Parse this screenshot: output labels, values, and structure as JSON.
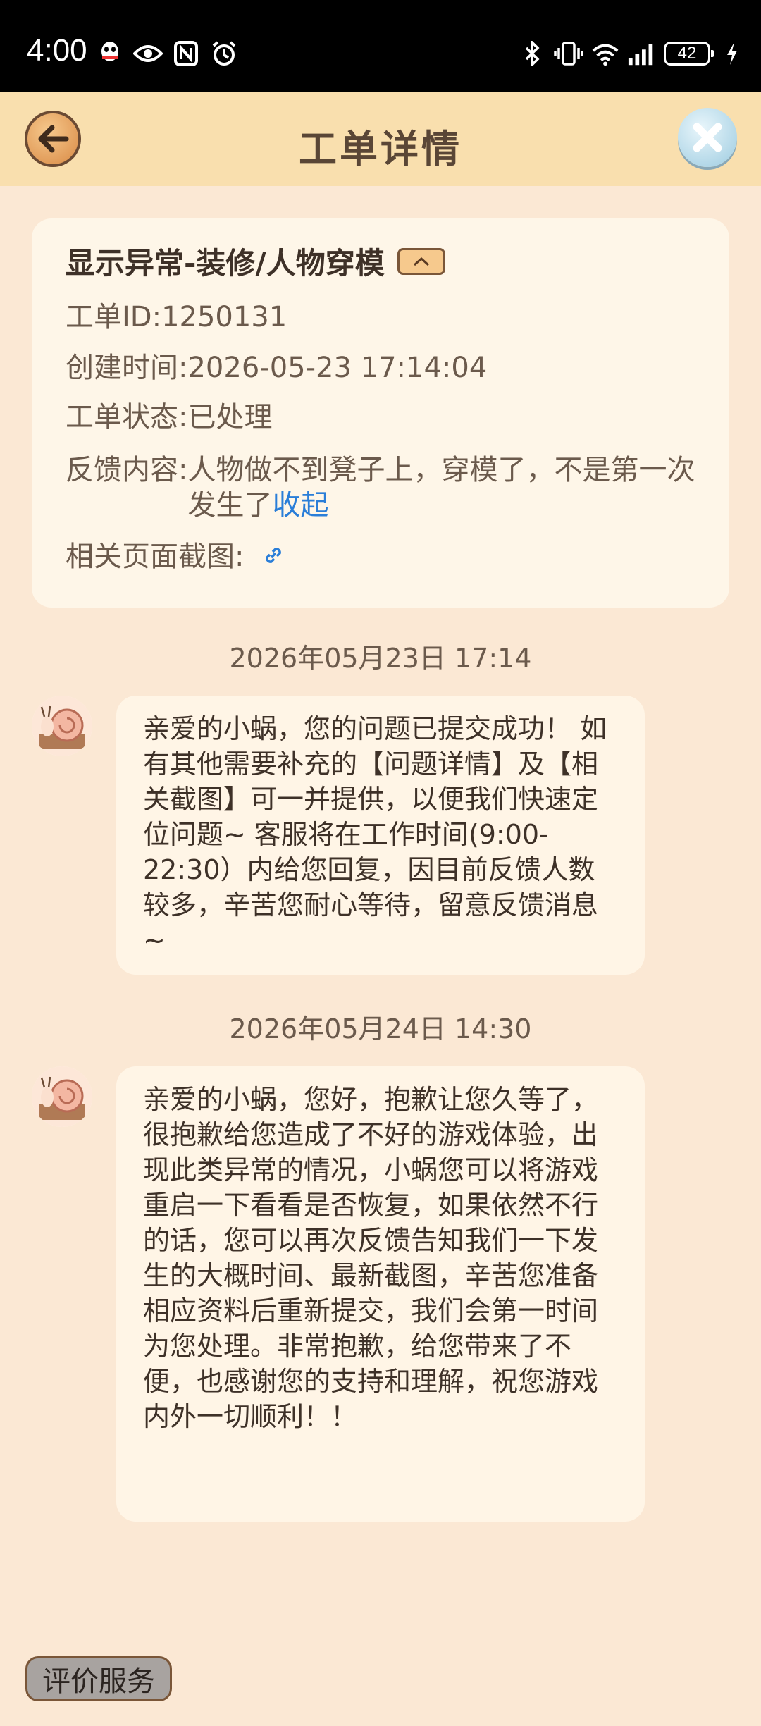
{
  "status_bar": {
    "time": "4:00",
    "battery": "42",
    "left_icons": [
      "qq-icon",
      "eye-icon",
      "nfc-icon",
      "alarm-icon"
    ],
    "right_icons": [
      "bluetooth-icon",
      "vibrate-icon",
      "wifi-icon",
      "signal-icon",
      "battery-icon",
      "charging-icon"
    ]
  },
  "header": {
    "title": "工单详情"
  },
  "ticket": {
    "title": "显示异常-装修/人物穿模",
    "id_label": "工单ID: ",
    "id_value": "1250131",
    "created_label": "创建时间: ",
    "created_value": "2026-05-23 17:14:04",
    "status_label": "工单状态: ",
    "status_value": "已处理",
    "feedback_label": "反馈内容: ",
    "feedback_value": "人物做不到凳子上，穿模了，不是第一次发生了",
    "collapse_link": "收起",
    "screenshot_label": "相关页面截图: "
  },
  "messages": [
    {
      "timestamp": "2026年05月23日 17:14",
      "text": "亲爱的小蜗，您的问题已提交成功！ 如有其他需要补充的【问题详情】及【相关截图】可一并提供，以便我们快速定位问题~ 客服将在工作时间(9:00-22:30）内给您回复，因目前反馈人数较多，辛苦您耐心等待，留意反馈消息~"
    },
    {
      "timestamp": "2026年05月24日 14:30",
      "text": "亲爱的小蜗，您好，抱歉让您久等了，\n很抱歉给您造成了不好的游戏体验，出现此类异常的情况，小蜗您可以将游戏重启一下看看是否恢复，如果依然不行的话，您可以再次反馈告知我们一下发生的大概时间、最新截图，辛苦您准备相应资料后重新提交，我们会第一时间为您处理。非常抱歉，给您带来了不便，也感谢您的支持和理解，祝您游戏内外一切顺利！！"
    }
  ],
  "footer": {
    "rate_button": "评价服务"
  },
  "colors": {
    "page_bg": "#fbe8d4",
    "header_bg": "#f9dfae",
    "card_bg": "#fef6e8",
    "bubble_bg": "#fff5e6",
    "link": "#2a7ed8"
  }
}
